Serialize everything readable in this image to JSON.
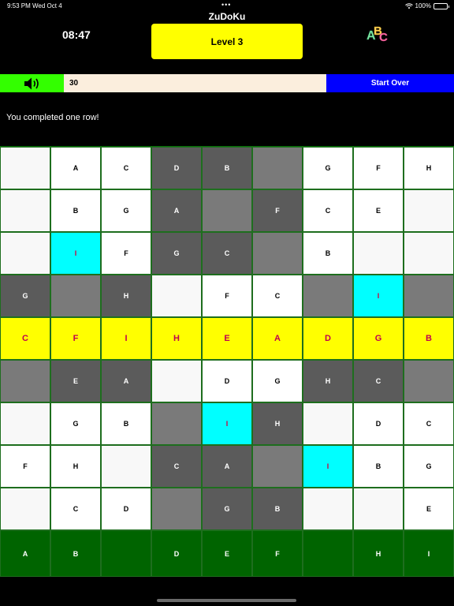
{
  "status_bar": {
    "time": "9:53 PM",
    "date": "Wed Oct 4",
    "dots": "•••",
    "battery": "100%"
  },
  "app_title": "ZuDoKu",
  "timer": "08:47",
  "level_label": "Level 3",
  "abc_icon_letters": [
    "A",
    "B",
    "C"
  ],
  "controls": {
    "score": "30",
    "start_over": "Start Over"
  },
  "message": "You completed one row!",
  "colors": {
    "yellow": "#ffff00",
    "cyan": "#00ffff",
    "green_sound": "#33ff00",
    "blue": "#0000ff",
    "dark_green": "#006400",
    "dark_gray": "#5b5b5b",
    "mid_gray": "#7a7a7a"
  },
  "board": {
    "rows": [
      [
        {
          "v": "",
          "t": "e"
        },
        {
          "v": "A",
          "t": "w"
        },
        {
          "v": "C",
          "t": "w"
        },
        {
          "v": "D",
          "t": "d"
        },
        {
          "v": "B",
          "t": "d"
        },
        {
          "v": "",
          "t": "m"
        },
        {
          "v": "G",
          "t": "w"
        },
        {
          "v": "F",
          "t": "w"
        },
        {
          "v": "H",
          "t": "w"
        }
      ],
      [
        {
          "v": "",
          "t": "e"
        },
        {
          "v": "B",
          "t": "w"
        },
        {
          "v": "G",
          "t": "w"
        },
        {
          "v": "A",
          "t": "d"
        },
        {
          "v": "",
          "t": "m"
        },
        {
          "v": "F",
          "t": "d"
        },
        {
          "v": "C",
          "t": "w"
        },
        {
          "v": "E",
          "t": "w"
        },
        {
          "v": "",
          "t": "e"
        }
      ],
      [
        {
          "v": "",
          "t": "e"
        },
        {
          "v": "I",
          "t": "c"
        },
        {
          "v": "F",
          "t": "w"
        },
        {
          "v": "G",
          "t": "d"
        },
        {
          "v": "C",
          "t": "d"
        },
        {
          "v": "",
          "t": "m"
        },
        {
          "v": "B",
          "t": "w"
        },
        {
          "v": "",
          "t": "e"
        },
        {
          "v": "",
          "t": "e"
        }
      ],
      [
        {
          "v": "G",
          "t": "d"
        },
        {
          "v": "",
          "t": "m"
        },
        {
          "v": "H",
          "t": "d"
        },
        {
          "v": "",
          "t": "e"
        },
        {
          "v": "F",
          "t": "w"
        },
        {
          "v": "C",
          "t": "w"
        },
        {
          "v": "",
          "t": "m"
        },
        {
          "v": "I",
          "t": "c"
        },
        {
          "v": "",
          "t": "m"
        }
      ],
      [
        {
          "v": "C",
          "t": "y"
        },
        {
          "v": "F",
          "t": "y"
        },
        {
          "v": "I",
          "t": "y"
        },
        {
          "v": "H",
          "t": "y"
        },
        {
          "v": "E",
          "t": "y"
        },
        {
          "v": "A",
          "t": "y"
        },
        {
          "v": "D",
          "t": "y"
        },
        {
          "v": "G",
          "t": "y"
        },
        {
          "v": "B",
          "t": "y"
        }
      ],
      [
        {
          "v": "",
          "t": "m"
        },
        {
          "v": "E",
          "t": "d"
        },
        {
          "v": "A",
          "t": "d"
        },
        {
          "v": "",
          "t": "e"
        },
        {
          "v": "D",
          "t": "w"
        },
        {
          "v": "G",
          "t": "w"
        },
        {
          "v": "H",
          "t": "d"
        },
        {
          "v": "C",
          "t": "d"
        },
        {
          "v": "",
          "t": "m"
        }
      ],
      [
        {
          "v": "",
          "t": "e"
        },
        {
          "v": "G",
          "t": "w"
        },
        {
          "v": "B",
          "t": "w"
        },
        {
          "v": "",
          "t": "m"
        },
        {
          "v": "I",
          "t": "c"
        },
        {
          "v": "H",
          "t": "d"
        },
        {
          "v": "",
          "t": "e"
        },
        {
          "v": "D",
          "t": "w"
        },
        {
          "v": "C",
          "t": "w"
        }
      ],
      [
        {
          "v": "F",
          "t": "w"
        },
        {
          "v": "H",
          "t": "w"
        },
        {
          "v": "",
          "t": "e"
        },
        {
          "v": "C",
          "t": "d"
        },
        {
          "v": "A",
          "t": "d"
        },
        {
          "v": "",
          "t": "m"
        },
        {
          "v": "I",
          "t": "c"
        },
        {
          "v": "B",
          "t": "w"
        },
        {
          "v": "G",
          "t": "w"
        }
      ],
      [
        {
          "v": "",
          "t": "e"
        },
        {
          "v": "C",
          "t": "w"
        },
        {
          "v": "D",
          "t": "w"
        },
        {
          "v": "",
          "t": "m"
        },
        {
          "v": "G",
          "t": "d"
        },
        {
          "v": "B",
          "t": "d"
        },
        {
          "v": "",
          "t": "e"
        },
        {
          "v": "",
          "t": "e"
        },
        {
          "v": "E",
          "t": "w"
        }
      ],
      [
        {
          "v": "A",
          "t": "g"
        },
        {
          "v": "B",
          "t": "g"
        },
        {
          "v": "",
          "t": "g"
        },
        {
          "v": "D",
          "t": "g"
        },
        {
          "v": "E",
          "t": "g"
        },
        {
          "v": "F",
          "t": "g"
        },
        {
          "v": "",
          "t": "g"
        },
        {
          "v": "H",
          "t": "g"
        },
        {
          "v": "I",
          "t": "g"
        }
      ]
    ]
  }
}
